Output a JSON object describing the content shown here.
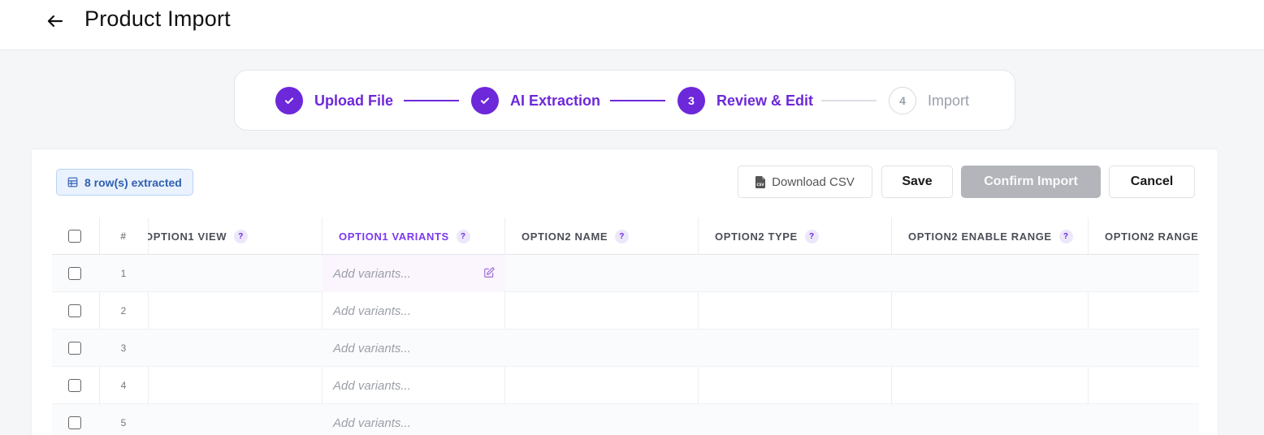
{
  "header": {
    "title": "Product Import"
  },
  "stepper": {
    "steps": [
      {
        "number": "1",
        "label": "Upload File",
        "state": "done"
      },
      {
        "number": "2",
        "label": "AI Extraction",
        "state": "done"
      },
      {
        "number": "3",
        "label": "Review & Edit",
        "state": "active"
      },
      {
        "number": "4",
        "label": "Import",
        "state": "todo"
      }
    ]
  },
  "toolbar": {
    "rows_extracted": "8 row(s) extracted",
    "download_csv": "Download CSV",
    "save": "Save",
    "confirm_import": "Confirm Import",
    "cancel": "Cancel"
  },
  "table": {
    "num_header": "#",
    "help_glyph": "?",
    "columns": [
      {
        "label": "OPTION1 VIEW"
      },
      {
        "label": "OPTION1 VARIANTS"
      },
      {
        "label": "OPTION2 NAME"
      },
      {
        "label": "OPTION2 TYPE"
      },
      {
        "label": "OPTION2 ENABLE RANGE"
      },
      {
        "label": "OPTION2 RANGE"
      }
    ],
    "rows": [
      {
        "num": "1",
        "variants": "Add variants..."
      },
      {
        "num": "2",
        "variants": "Add variants..."
      },
      {
        "num": "3",
        "variants": "Add variants..."
      },
      {
        "num": "4",
        "variants": "Add variants..."
      },
      {
        "num": "5",
        "variants": "Add variants..."
      }
    ]
  },
  "colors": {
    "accent": "#6d28d9",
    "disabled": "#b3b5ba"
  }
}
